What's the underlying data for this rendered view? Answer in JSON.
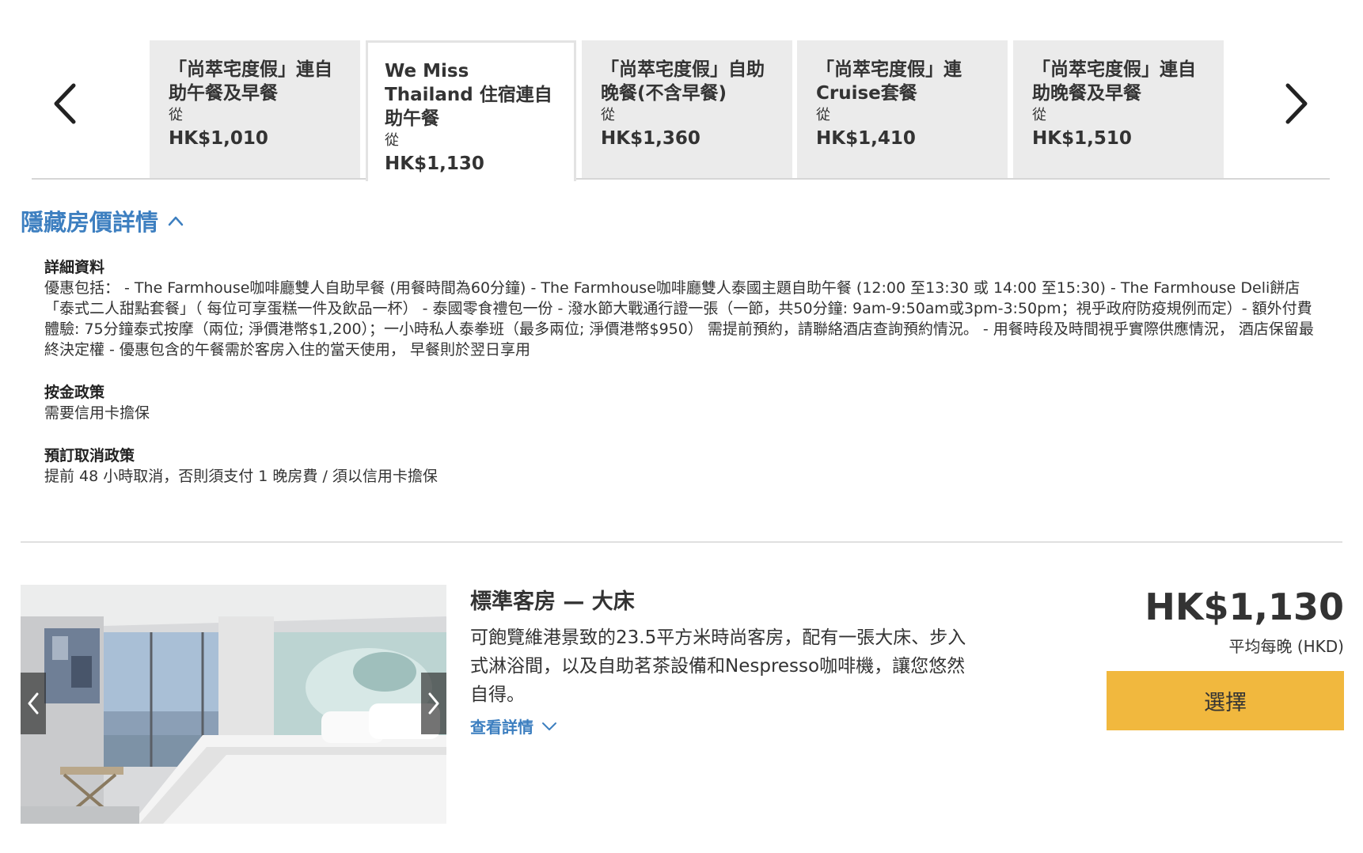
{
  "rate_tabs": [
    {
      "name": "「尚萃宅度假」連自助午餐及早餐",
      "from_label": "從",
      "price": "HK$1,010",
      "active": false
    },
    {
      "name": "We Miss Thailand 住宿連自助午餐",
      "from_label": "從",
      "price": "HK$1,130",
      "active": true
    },
    {
      "name": "「尚萃宅度假」自助晚餐(不含早餐)",
      "from_label": "從",
      "price": "HK$1,360",
      "active": false
    },
    {
      "name": "「尚萃宅度假」連Cruise套餐",
      "from_label": "從",
      "price": "HK$1,410",
      "active": false
    },
    {
      "name": "「尚萃宅度假」連自助晚餐及早餐",
      "from_label": "從",
      "price": "HK$1,510",
      "active": false
    }
  ],
  "details_toggle": "隱藏房價詳情",
  "details": {
    "info_title": "詳細資料",
    "info_text": "優惠包括： - The Farmhouse咖啡廳雙人自助早餐 (用餐時間為60分鐘) - The Farmhouse咖啡廳雙人泰國主題自助午餐 (12:00 至13:30 或 14:00 至15:30) - The Farmhouse Deli餅店「泰式二人甜點套餐」（ 每位可享蛋糕一件及飲品一杯） - 泰國零食禮包一份 - 潑水節大戰通行證一張（一節，共50分鐘: 9am-9:50am或3pm-3:50pm；視乎政府防疫規例而定）- 額外付費體驗: 75分鐘泰式按摩（兩位; 淨價港幣$1,200）；一小時私人泰拳班（最多兩位; 淨價港幣$950） 需提前預約，請聯絡酒店查詢預約情況。 - 用餐時段及時間視乎實際供應情況， 酒店保留最終決定權 - 優惠包含的午餐需於客房入住的當天使用， 早餐則於翌日享用",
    "deposit_title": "按金政策",
    "deposit_text": "需要信用卡擔保",
    "cancel_title": "預訂取消政策",
    "cancel_text": "提前 48 小時取消，否則須支付 1 晚房費 / 須以信用卡擔保"
  },
  "room": {
    "title": "標準客房 — 大床",
    "description": "可飽覽維港景致的23.5平方米時尚客房，配有一張大床、步入式淋浴間，以及自助茗茶設備和Nespresso咖啡機，讓您悠然自得。",
    "more_link": "查看詳情",
    "price": "HK$1,130",
    "price_note": "平均每晚 (HKD)",
    "select_label": "選擇"
  },
  "colors": {
    "accent_blue": "#3d7fc0",
    "select_button": "#f1b83e",
    "tab_bg": "#ebebeb"
  },
  "icons": [
    "chevron-left-icon",
    "chevron-right-icon",
    "chevron-up-icon",
    "chevron-down-icon"
  ]
}
